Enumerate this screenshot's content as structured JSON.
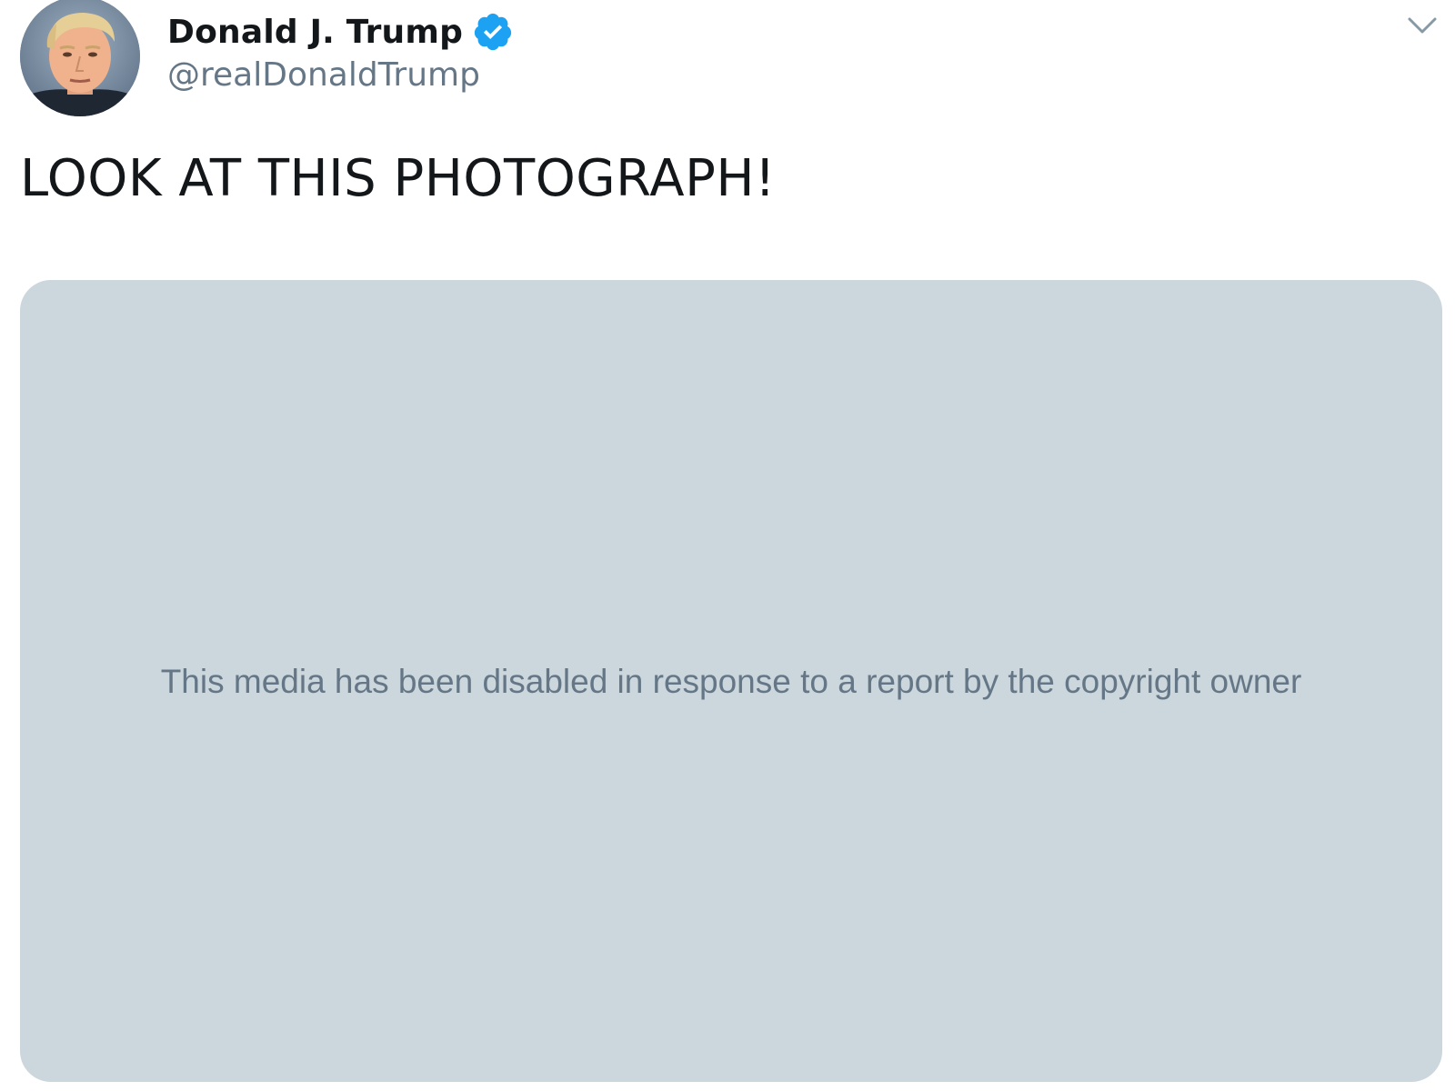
{
  "author": {
    "display_name": "Donald J. Trump",
    "handle": "@realDonaldTrump",
    "verified": true,
    "avatar_icon": "profile-photo"
  },
  "tweet": {
    "text": "LOOK AT THIS PHOTOGRAPH!"
  },
  "media": {
    "message": "This media has been disabled in response to a report by the copyright owner"
  },
  "icons": {
    "verified": "verified-badge-icon",
    "menu": "chevron-down-icon"
  },
  "colors": {
    "verified_blue": "#1da1f2",
    "media_background": "#ccd6dd",
    "secondary_text": "#657786",
    "primary_text": "#14171a"
  }
}
